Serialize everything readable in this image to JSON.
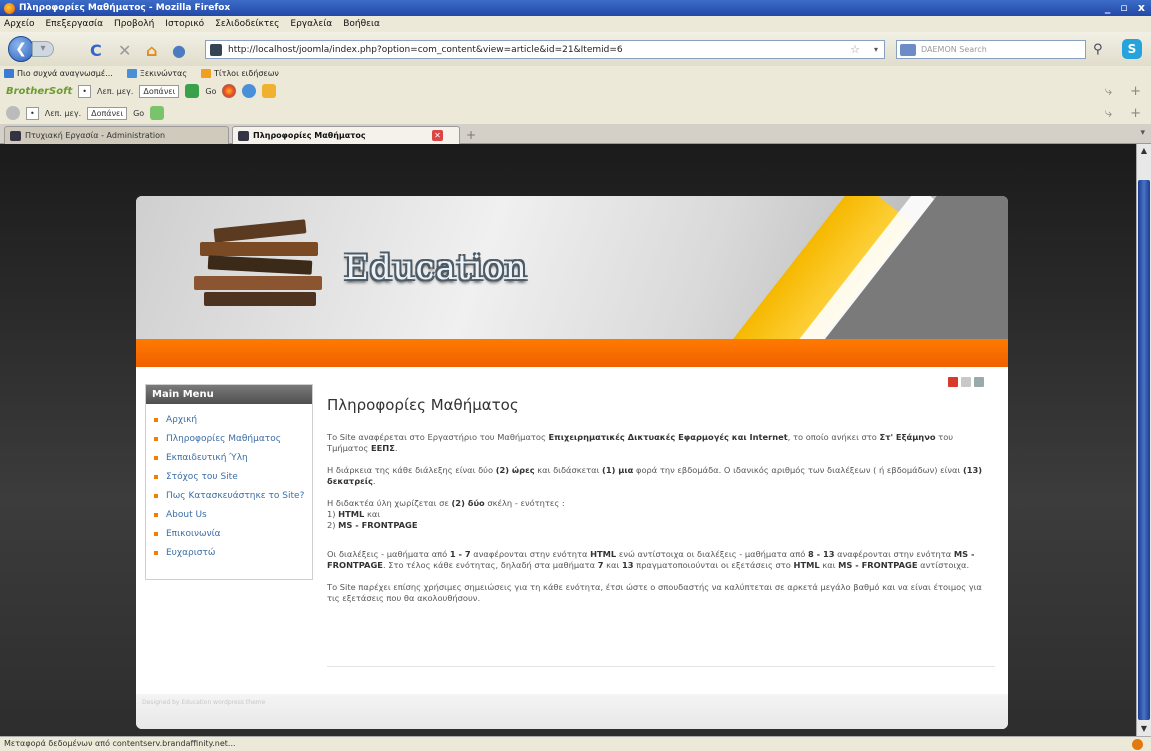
{
  "window": {
    "title": "Πληροφορίες Μαθήματος - Mozilla Firefox",
    "controls": [
      "_",
      "▫",
      "x"
    ]
  },
  "menubar": [
    "Αρχείο",
    "Επεξεργασία",
    "Προβολή",
    "Ιστορικό",
    "Σελιδοδείκτες",
    "Εργαλεία",
    "Βοήθεια"
  ],
  "navbar": {
    "url": "http://localhost/joomla/index.php?option=com_content&view=article&id=21&Itemid=6",
    "search_placeholder": "DAEMON Search"
  },
  "bookmarks": [
    {
      "label": "Πιο συχνά αναγνωσμέ...",
      "color": "#3a7bd5"
    },
    {
      "label": "Ξεκινώντας",
      "color": "#4c8fd6"
    },
    {
      "label": "Τίτλοι ειδήσεων",
      "color": "#f0a020"
    }
  ],
  "toolbar1": {
    "brand": "BrotherSoft",
    "font_label": "Λεπ. μεγ.",
    "select": "Δοπάνει",
    "go": "Go"
  },
  "toolbar2": {
    "font_label": "Λεπ. μεγ.",
    "select": "Δοπάνει",
    "go": "Go"
  },
  "tabs": [
    {
      "label": "Πτυχιακή Εργασία - Administration"
    },
    {
      "label": "Πληροφορίες Μαθήματος"
    }
  ],
  "site": {
    "banner_text": "Education",
    "menu": {
      "heading": "Main Menu",
      "items": [
        "Αρχική",
        "Πληροφορίες Μαθήματος",
        "Εκπαιδευτική Ύλη",
        "Στόχος του Site",
        "Πως Κατασκευάστηκε το Site?",
        "About Us",
        "Επικοινωνία",
        "Ευχαριστώ"
      ]
    },
    "article": {
      "title": "Πληροφορίες Μαθήματος",
      "p1_pre": "Το Site αναφέρεται στο Εργαστήριο του Μαθήματος ",
      "p1_b1": "Επιχειρηματικές Δικτυακές Εφαρμογές και Internet",
      "p1_mid": ", το οποίο ανήκει στο ",
      "p1_b2": "Στ' Εξάμηνο",
      "p1_post": " του Τμήματος ",
      "p1_b3": "ΕΕΠΣ",
      "p1_end": ".",
      "p2_a": "Η διάρκεια της κάθε διάλεξης είναι δύο ",
      "p2_b1": "(2) ώρες",
      "p2_c": " και διδάσκεται ",
      "p2_b2": "(1) μια",
      "p2_d": " φορά την εβδομάδα. Ο ιδανικός αριθμός των διαλέξεων ( ή εβδομάδων) είναι ",
      "p2_b3": "(13) δεκατρείς",
      "p2_e": ".",
      "p3_a": "Η διδακτέα ύλη χωρίζεται σε ",
      "p3_b1": "(2) δύο",
      "p3_c": " σκέλη - ενότητες :",
      "p3_l1a": "1) ",
      "p3_l1b": "HTML",
      "p3_l1c": " και",
      "p3_l2a": "2) ",
      "p3_l2b": "MS - FRONTPAGE",
      "p4_a": "Οι διαλέξεις - μαθήματα από ",
      "p4_b1": "1 - 7",
      "p4_c": " αναφέρονται στην ενότητα ",
      "p4_b2": "HTML",
      "p4_d": " ενώ αντίστοιχα οι διαλέξεις - μαθήματα από ",
      "p4_b3": "8 - 13",
      "p4_e": " αναφέρονται στην ενότητα ",
      "p4_b4": "MS - FRONTPAGE",
      "p4_f": ". Στο τέλος κάθε ενότητας, δηλαδή στα μαθήματα ",
      "p4_b5": "7",
      "p4_g": " και ",
      "p4_b6": "13",
      "p4_h": " πραγματοποιούνται οι εξετάσεις στο ",
      "p4_b7": "HTML",
      "p4_i": " και ",
      "p4_b8": "MS - FRONTPAGE",
      "p4_j": " αντίστοιχα.",
      "p5": "Το Site παρέχει επίσης χρήσιμες σημειώσεις για τη κάθε ενότητα, έτσι ώστε ο σπουδαστής να καλύπτεται σε αρκετά μεγάλο βαθμό και να είναι έτοιμος για τις εξετάσεις που θα ακολουθήσουν."
    },
    "footer": "Designed by Education wordpress theme"
  },
  "statusbar": "Μεταφορά δεδομένων από contentserv.brandaffinity.net...",
  "colors": {
    "accent_orange": "#f06a00",
    "menu_bullet": "#f08000",
    "link": "#3b6ea5"
  }
}
